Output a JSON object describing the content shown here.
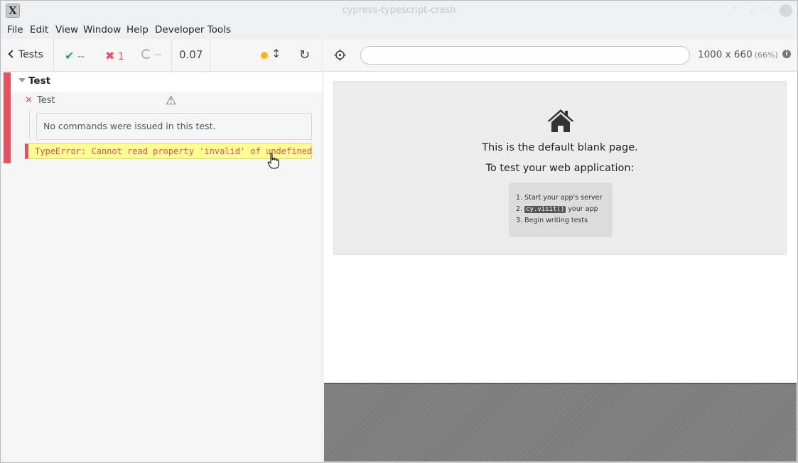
{
  "window": {
    "title": "cypress-typescript-crash",
    "logo": "X"
  },
  "menu": [
    "File",
    "Edit",
    "View",
    "Window",
    "Help",
    "Developer Tools"
  ],
  "reporter": {
    "tests_label": "Tests",
    "passed": "--",
    "failed": "1",
    "pending": "--",
    "duration": "0.07",
    "suite": {
      "title": "Test",
      "test": {
        "title": "Test",
        "no_commands": "No commands were issued in this test.",
        "error": "TypeError: Cannot read property 'invalid' of undefined"
      }
    }
  },
  "aut": {
    "url": "",
    "viewport": "1000 x 660",
    "zoom": "(66%)",
    "blank": {
      "line1": "This is the default blank page.",
      "line2": "To test your web application:",
      "step1": "Start your app's server",
      "step2_code": "cy.visit()",
      "step2_text": "your app",
      "step3": "Begin writing tests"
    }
  },
  "colors": {
    "fail": "#e94f5f",
    "pass": "#2fa35f",
    "error_bg": "#fdff8f",
    "amber": "#f8b21f"
  }
}
